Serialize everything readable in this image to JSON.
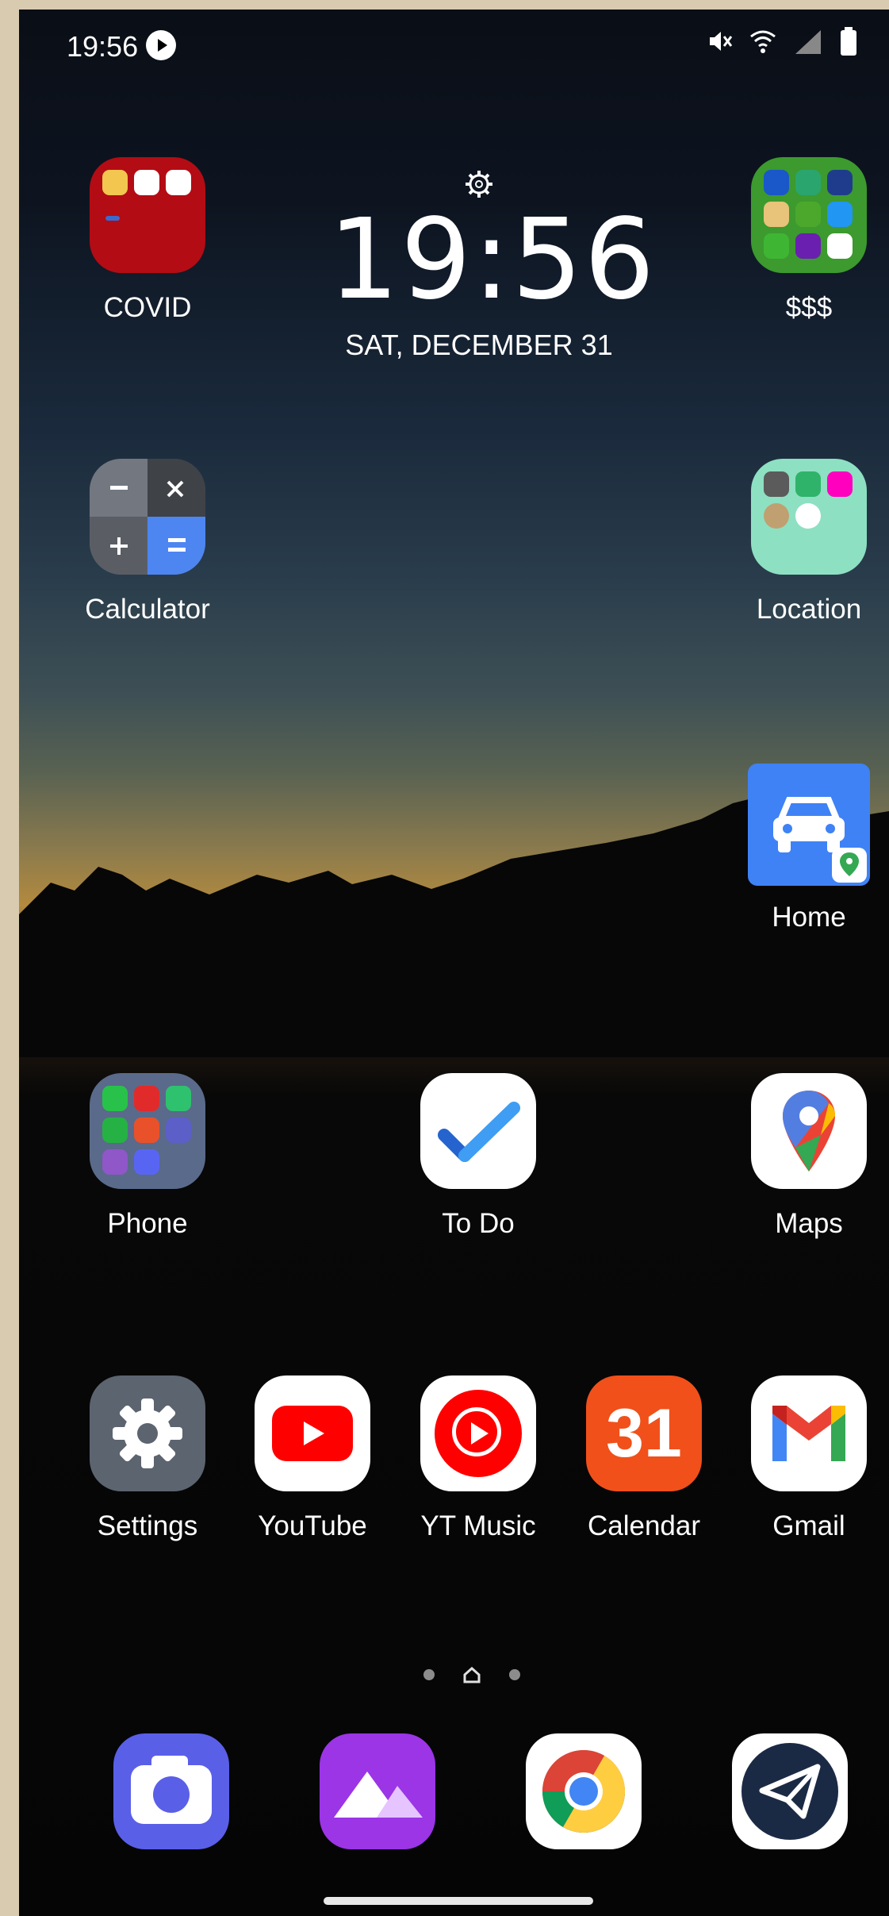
{
  "status_bar": {
    "time": "19:56"
  },
  "clock_widget": {
    "time": "19:56",
    "date": "SAT, DECEMBER 31"
  },
  "apps": {
    "covid": "COVID",
    "money": "$$$",
    "calculator": "Calculator",
    "location": "Location",
    "home": "Home",
    "phone": "Phone",
    "todo": "To Do",
    "maps": "Maps",
    "settings": "Settings",
    "youtube": "YouTube",
    "ytmusic": "YT Music",
    "calendar": "Calendar",
    "calendar_icon_day": "31",
    "gmail": "Gmail"
  },
  "dock": [
    "camera",
    "gallery",
    "chrome",
    "telegram"
  ],
  "colors": {
    "covid_folder": "#b30c14",
    "money_folder": "#3c9a2e",
    "location_folder": "#8ee0c2",
    "home_tile": "#3f82f5",
    "calendar_tile": "#f1501a"
  }
}
